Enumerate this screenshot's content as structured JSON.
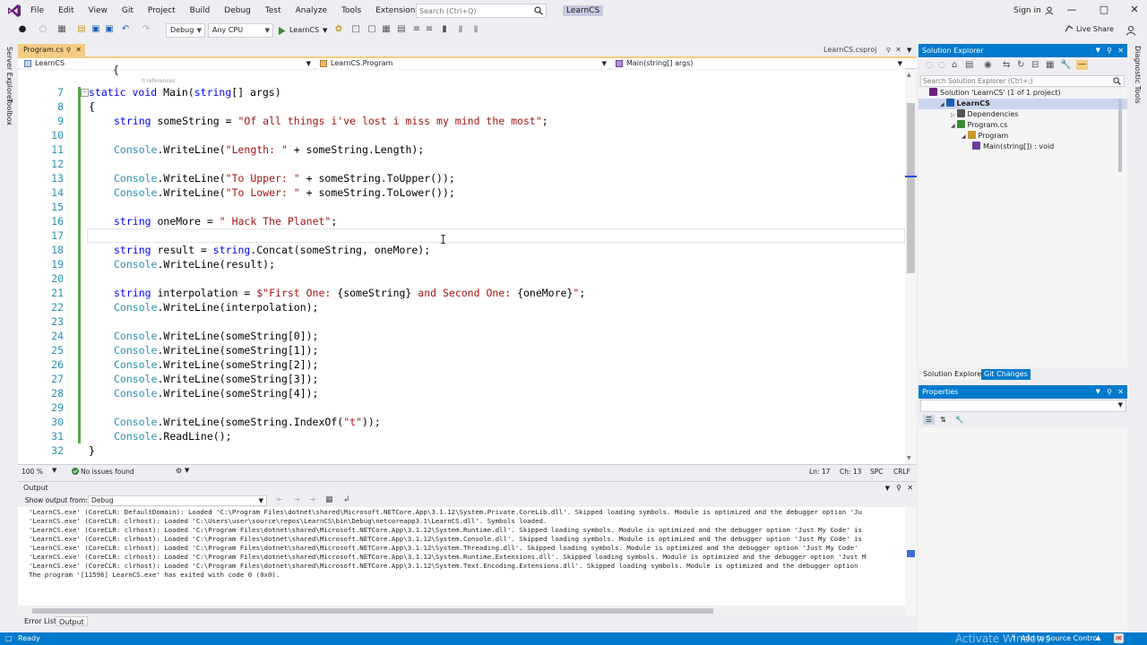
{
  "menubar": {
    "items": [
      "File",
      "Edit",
      "View",
      "Git",
      "Project",
      "Build",
      "Debug",
      "Test",
      "Analyze",
      "Tools",
      "Extensions",
      "Window",
      "Help"
    ],
    "search_placeholder": "Search (Ctrl+Q)",
    "title": "LearnCS",
    "sign_in": "Sign in"
  },
  "toolbar": {
    "config": "Debug",
    "platform": "Any CPU",
    "start_label": "LearnCS",
    "live_share": "Live Share"
  },
  "side": {
    "left": [
      "Server Explorer",
      "Toolbox"
    ],
    "right": [
      "Diagnostic Tools"
    ]
  },
  "tabs": {
    "active": "Program.cs",
    "other": "LearnCS.csproj"
  },
  "navbar": {
    "project": "LearnCS",
    "class": "LearnCS.Program",
    "member": "Main(string[] args)"
  },
  "editor": {
    "refs_hint": "0 references",
    "lines": [
      {
        "n": "7",
        "segs": [
          [
            "kw",
            "static "
          ],
          [
            "kw",
            "void "
          ],
          [
            "",
            "Main("
          ],
          [
            "kw",
            "string"
          ],
          [
            "",
            "[] args)"
          ]
        ],
        "indent": 2
      },
      {
        "n": "8",
        "segs": [
          [
            "",
            "{"
          ]
        ],
        "indent": 2
      },
      {
        "n": "9",
        "segs": [
          [
            "kw",
            "string "
          ],
          [
            "",
            "someString = "
          ],
          [
            "st",
            "\"Of all things i've lost i miss my mind the most\""
          ],
          [
            "",
            ";"
          ]
        ],
        "indent": 3
      },
      {
        "n": "10",
        "segs": [],
        "indent": 0
      },
      {
        "n": "11",
        "segs": [
          [
            "ty",
            "Console"
          ],
          [
            "",
            ".WriteLine("
          ],
          [
            "st",
            "\"Length: \""
          ],
          [
            "",
            " + someString.Length);"
          ]
        ],
        "indent": 3
      },
      {
        "n": "12",
        "segs": [],
        "indent": 0
      },
      {
        "n": "13",
        "segs": [
          [
            "ty",
            "Console"
          ],
          [
            "",
            ".WriteLine("
          ],
          [
            "st",
            "\"To Upper: \""
          ],
          [
            "",
            " + someString.ToUpper());"
          ]
        ],
        "indent": 3
      },
      {
        "n": "14",
        "segs": [
          [
            "ty",
            "Console"
          ],
          [
            "",
            ".WriteLine("
          ],
          [
            "st",
            "\"To Lower: \""
          ],
          [
            "",
            " + someString.ToLower());"
          ]
        ],
        "indent": 3
      },
      {
        "n": "15",
        "segs": [],
        "indent": 0
      },
      {
        "n": "16",
        "segs": [
          [
            "kw",
            "string "
          ],
          [
            "",
            "oneMore = "
          ],
          [
            "st",
            "\" Hack The Planet\""
          ],
          [
            "",
            ";"
          ]
        ],
        "indent": 3
      },
      {
        "n": "17",
        "segs": [],
        "indent": 0
      },
      {
        "n": "18",
        "segs": [
          [
            "kw",
            "string "
          ],
          [
            "",
            "result = "
          ],
          [
            "kw",
            "string"
          ],
          [
            "",
            ".Concat(someString, oneMore);"
          ]
        ],
        "indent": 3
      },
      {
        "n": "19",
        "segs": [
          [
            "ty",
            "Console"
          ],
          [
            "",
            ".WriteLine(result);"
          ]
        ],
        "indent": 3
      },
      {
        "n": "20",
        "segs": [],
        "indent": 0
      },
      {
        "n": "21",
        "segs": [
          [
            "kw",
            "string "
          ],
          [
            "",
            "interpolation = "
          ],
          [
            "st",
            "$\"First One: "
          ],
          [
            "",
            "{someString}"
          ],
          [
            "st",
            " and Second One: "
          ],
          [
            "",
            "{oneMore}"
          ],
          [
            "st",
            "\""
          ],
          [
            "",
            ";"
          ]
        ],
        "indent": 3
      },
      {
        "n": "22",
        "segs": [
          [
            "ty",
            "Console"
          ],
          [
            "",
            ".WriteLine(interpolation);"
          ]
        ],
        "indent": 3
      },
      {
        "n": "23",
        "segs": [],
        "indent": 0
      },
      {
        "n": "24",
        "segs": [
          [
            "ty",
            "Console"
          ],
          [
            "",
            ".WriteLine(someString[0]);"
          ]
        ],
        "indent": 3
      },
      {
        "n": "25",
        "segs": [
          [
            "ty",
            "Console"
          ],
          [
            "",
            ".WriteLine(someString[1]);"
          ]
        ],
        "indent": 3
      },
      {
        "n": "26",
        "segs": [
          [
            "ty",
            "Console"
          ],
          [
            "",
            ".WriteLine(someString[2]);"
          ]
        ],
        "indent": 3
      },
      {
        "n": "27",
        "segs": [
          [
            "ty",
            "Console"
          ],
          [
            "",
            ".WriteLine(someString[3]);"
          ]
        ],
        "indent": 3
      },
      {
        "n": "28",
        "segs": [
          [
            "ty",
            "Console"
          ],
          [
            "",
            ".WriteLine(someString[4]);"
          ]
        ],
        "indent": 3
      },
      {
        "n": "29",
        "segs": [],
        "indent": 0
      },
      {
        "n": "30",
        "segs": [
          [
            "ty",
            "Console"
          ],
          [
            "",
            ".WriteLine(someString.IndexOf("
          ],
          [
            "st",
            "\"t\""
          ],
          [
            "",
            "));"
          ]
        ],
        "indent": 3
      },
      {
        "n": "31",
        "segs": [
          [
            "ty",
            "Console"
          ],
          [
            "",
            ".ReadLine();"
          ]
        ],
        "indent": 3
      },
      {
        "n": "32",
        "segs": [
          [
            "",
            "}"
          ]
        ],
        "indent": 2
      }
    ],
    "status": {
      "zoom": "100 %",
      "issues": "No issues found",
      "ln": "Ln: 17",
      "ch": "Ch: 13",
      "spc": "SPC",
      "crlf": "CRLF"
    }
  },
  "solution_explorer": {
    "title": "Solution Explorer",
    "search_placeholder": "Search Solution Explorer (Ctrl+;)",
    "tree": [
      {
        "label": "Solution 'LearnCS' (1 of 1 project)",
        "level": 0,
        "icon": "solution-icon"
      },
      {
        "label": "LearnCS",
        "level": 1,
        "icon": "project-icon",
        "bold": true
      },
      {
        "label": "Dependencies",
        "level": 2,
        "icon": "dependencies-icon"
      },
      {
        "label": "Program.cs",
        "level": 2,
        "icon": "csharp-file-icon"
      },
      {
        "label": "Program",
        "level": 3,
        "icon": "class-icon"
      },
      {
        "label": "Main(string[]) : void",
        "level": 4,
        "icon": "method-icon"
      }
    ],
    "tabs": [
      "Solution Explorer",
      "Git Changes"
    ]
  },
  "properties": {
    "title": "Properties"
  },
  "output": {
    "title": "Output",
    "show_from_label": "Show output from:",
    "source": "Debug",
    "lines": [
      "'LearnCS.exe' (CoreCLR: DefaultDomain): Loaded 'C:\\Program Files\\dotnet\\shared\\Microsoft.NETCore.App\\3.1.12\\System.Private.CoreLib.dll'. Skipped loading symbols. Module is optimized and the debugger option 'Ju",
      "'LearnCS.exe' (CoreCLR: clrhost): Loaded 'C:\\Users\\user\\source\\repos\\LearnCS\\bin\\Debug\\netcoreapp3.1\\LearnCS.dll'. Symbols loaded.",
      "'LearnCS.exe' (CoreCLR: clrhost): Loaded 'C:\\Program Files\\dotnet\\shared\\Microsoft.NETCore.App\\3.1.12\\System.Runtime.dll'. Skipped loading symbols. Module is optimized and the debugger option 'Just My Code' is",
      "'LearnCS.exe' (CoreCLR: clrhost): Loaded 'C:\\Program Files\\dotnet\\shared\\Microsoft.NETCore.App\\3.1.12\\System.Console.dll'. Skipped loading symbols. Module is optimized and the debugger option 'Just My Code' is",
      "'LearnCS.exe' (CoreCLR: clrhost): Loaded 'C:\\Program Files\\dotnet\\shared\\Microsoft.NETCore.App\\3.1.12\\System.Threading.dll'. Skipped loading symbols. Module is optimized and the debugger option 'Just My Code'",
      "'LearnCS.exe' (CoreCLR: clrhost): Loaded 'C:\\Program Files\\dotnet\\shared\\Microsoft.NETCore.App\\3.1.12\\System.Runtime.Extensions.dll'. Skipped loading symbols. Module is optimized and the debugger option 'Just M",
      "'LearnCS.exe' (CoreCLR: clrhost): Loaded 'C:\\Program Files\\dotnet\\shared\\Microsoft.NETCore.App\\3.1.12\\System.Text.Encoding.Extensions.dll'. Skipped loading symbols. Module is optimized and the debugger option",
      "The program '[11596] LearnCS.exe' has exited with code 0 (0x0)."
    ],
    "tabs": [
      "Error List",
      "Output"
    ]
  },
  "statusbar": {
    "ready": "Ready",
    "source_control": "Add to Source Control",
    "watermark": "Activate Windows"
  },
  "colors": {
    "accent": "#007acc",
    "tab_active": "#f5cc84",
    "keyword": "#0000ff",
    "type": "#2b91af",
    "string": "#a31515"
  }
}
